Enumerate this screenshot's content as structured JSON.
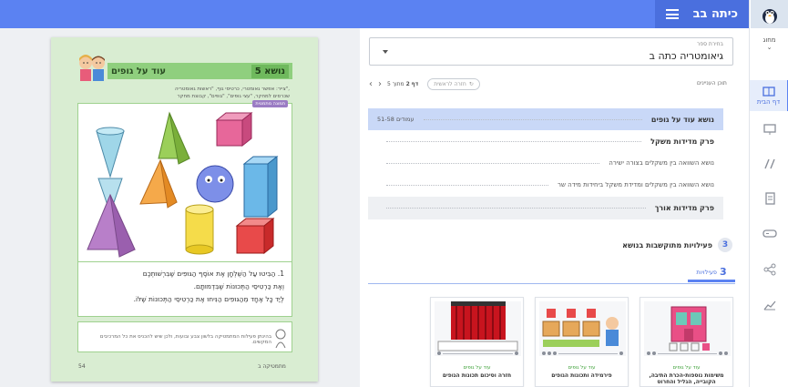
{
  "header": {
    "class_title": "כיתה בב"
  },
  "sidebar": {
    "items": [
      {
        "label": "מחוג"
      },
      {
        "label": "דף הבית"
      },
      {
        "label": ""
      },
      {
        "label": ""
      },
      {
        "label": ""
      },
      {
        "label": ""
      },
      {
        "label": ""
      },
      {
        "label": ""
      }
    ]
  },
  "book": {
    "topic_number": "נושא 5",
    "topic_title": "עוד על גופים",
    "subtitle_1": "צייר: אפשר גאומטרי, כרטיסי גוף, \"ראשות גאומטריה\",",
    "subtitle_2": "שכרסים למחקר, \"עצי גופים\", \"גופים\", קבוצת מחקר",
    "illustration_tag": "תמונה מתמטית",
    "exercise_lines": [
      "1. הַבִּיטוּ עַל הַשֻּׁלְחָן אֶת אוֹסֶף הַגּוּפִים שֶׁבִּרְשׁוּתְכֶם",
      "וְאֶת כַּרְטִיסֵי הַתְּכוּנוֹת שֶׁבִּדְמוּתָם.",
      "לְיַד כָּל אֶחָד מֵהַגּוּפִים הַנִּיחוּ אֶת כַּרְטִיסֵי הַתְּכוּנוֹת שֶׁלּוֹ."
    ],
    "note_text": "בהינתן פעילות המתמטיקה בלשון צבע ובועות, ולכן שיש להכניס את כל המרכיבים המקשים.",
    "page_left": "54",
    "page_right": "מתמטיקה ב"
  },
  "selector": {
    "label": "בחירת ספר",
    "value": "גיאומטריה כתה ב"
  },
  "toc": {
    "label": "תוכן העניינים",
    "page_current": "2",
    "page_total": "5",
    "page_word": "דף",
    "page_of": "מתוך",
    "back_label": "חזרה לראשית"
  },
  "toc_rows": [
    {
      "name": "נושא עוד על גופים",
      "pages": "51-58 עמודים"
    },
    {
      "name": "פרק מדידות משקל",
      "pages": ""
    },
    {
      "name": "נושא השוואה בין משקלים בצורה ישירה",
      "pages": ""
    },
    {
      "name": "נושא השוואה בין משקלים ומדידת משקל ביחידות מידה שר",
      "pages": ""
    },
    {
      "name": "פרק מדידות אורך",
      "pages": ""
    }
  ],
  "activities": {
    "count": "3",
    "title": "פעילויות מתוקשבות בנושא",
    "tab_count": "3",
    "tab_label": "פעילויות"
  },
  "cards": [
    {
      "category": "עוד על גופים",
      "name": "משימות נוספות-הכרת התיבה, הקובייה, הגליל והחרוט"
    },
    {
      "category": "עוד על גופים",
      "name": "פירמידה ותכונות הגופים"
    },
    {
      "category": "עוד על גופים",
      "name": "חזרה וסיכום תכונות הגופים"
    }
  ],
  "colors": {
    "topbar": "#5b82f2",
    "accent": "#4a6fde",
    "book_green": "#8fcf7e",
    "highlight_row": "#c9d8f7"
  }
}
